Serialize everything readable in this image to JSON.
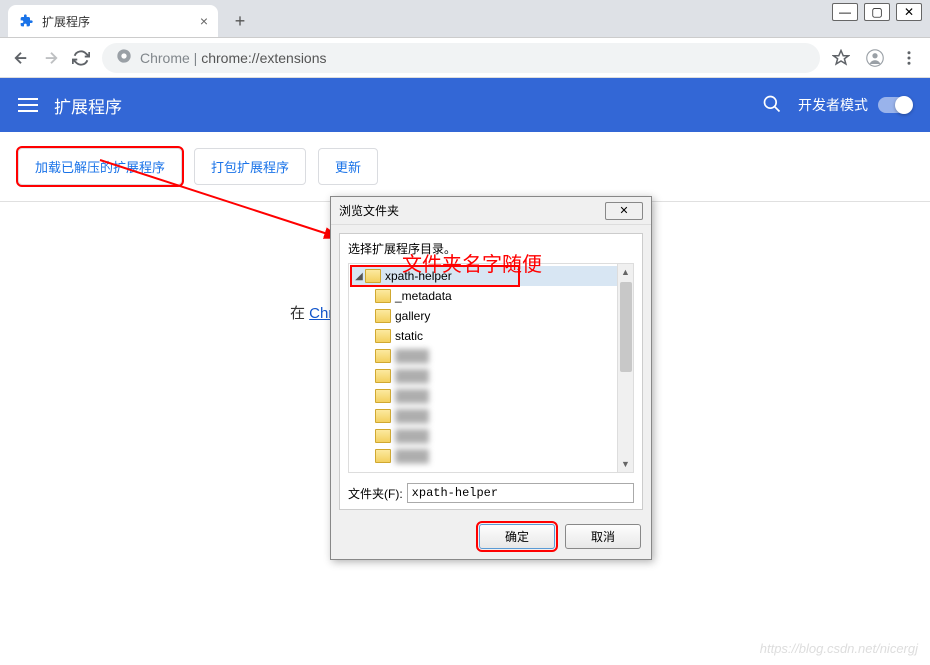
{
  "tab": {
    "title": "扩展程序"
  },
  "url": {
    "prefix": "Chrome",
    "path": "chrome://extensions"
  },
  "header": {
    "title": "扩展程序",
    "dev_mode": "开发者模式"
  },
  "toolbar": {
    "load_unpacked": "加载已解压的扩展程序",
    "pack": "打包扩展程序",
    "update": "更新"
  },
  "content": {
    "hint_prefix": "在 ",
    "hint_link": "Chr"
  },
  "annotation": "文件夹名字随便",
  "dialog": {
    "title": "浏览文件夹",
    "instruction": "选择扩展程序目录。",
    "tree": [
      {
        "label": "xpath-helper",
        "depth": 1,
        "expanded": true,
        "selected": true
      },
      {
        "label": "_metadata",
        "depth": 2
      },
      {
        "label": "gallery",
        "depth": 2
      },
      {
        "label": "static",
        "depth": 2
      },
      {
        "label": "blur1",
        "depth": 2,
        "blurred": true
      },
      {
        "label": "blur2",
        "depth": 2,
        "blurred": true
      },
      {
        "label": "blur3",
        "depth": 2,
        "blurred": true
      },
      {
        "label": "blur4",
        "depth": 2,
        "blurred": true
      },
      {
        "label": "blur5",
        "depth": 2,
        "blurred": true
      },
      {
        "label": "blur6",
        "depth": 2,
        "blurred": true
      }
    ],
    "folder_label": "文件夹(F):",
    "folder_value": "xpath-helper",
    "ok": "确定",
    "cancel": "取消"
  },
  "watermark": "https://blog.csdn.net/nicergj"
}
